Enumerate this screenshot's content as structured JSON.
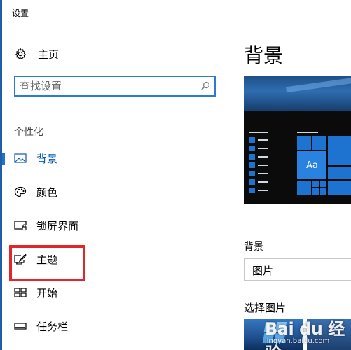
{
  "window": {
    "title": "设置"
  },
  "sidebar": {
    "home_label": "主页",
    "search": {
      "placeholder": "查找设置",
      "value": ""
    },
    "section_title": "个性化",
    "items": [
      {
        "label": "背景",
        "icon": "image-icon",
        "active": true
      },
      {
        "label": "颜色",
        "icon": "palette-icon",
        "active": false
      },
      {
        "label": "锁屏界面",
        "icon": "lock-screen-icon",
        "active": false
      },
      {
        "label": "主题",
        "icon": "theme-brush-icon",
        "active": false,
        "highlighted": true
      },
      {
        "label": "开始",
        "icon": "start-grid-icon",
        "active": false
      },
      {
        "label": "任务栏",
        "icon": "taskbar-icon",
        "active": false
      }
    ]
  },
  "content": {
    "title": "背景",
    "preview_tile_label": "Aa",
    "background_label": "背景",
    "background_select_value": "图片",
    "choose_picture_label": "选择图片"
  },
  "watermark": {
    "main": "Bai du 经验",
    "sub": "jingyan.baidu.com"
  },
  "colors": {
    "accent": "#1e73d0",
    "highlight": "#e0262a",
    "window_edge": "#1e5fa8"
  }
}
